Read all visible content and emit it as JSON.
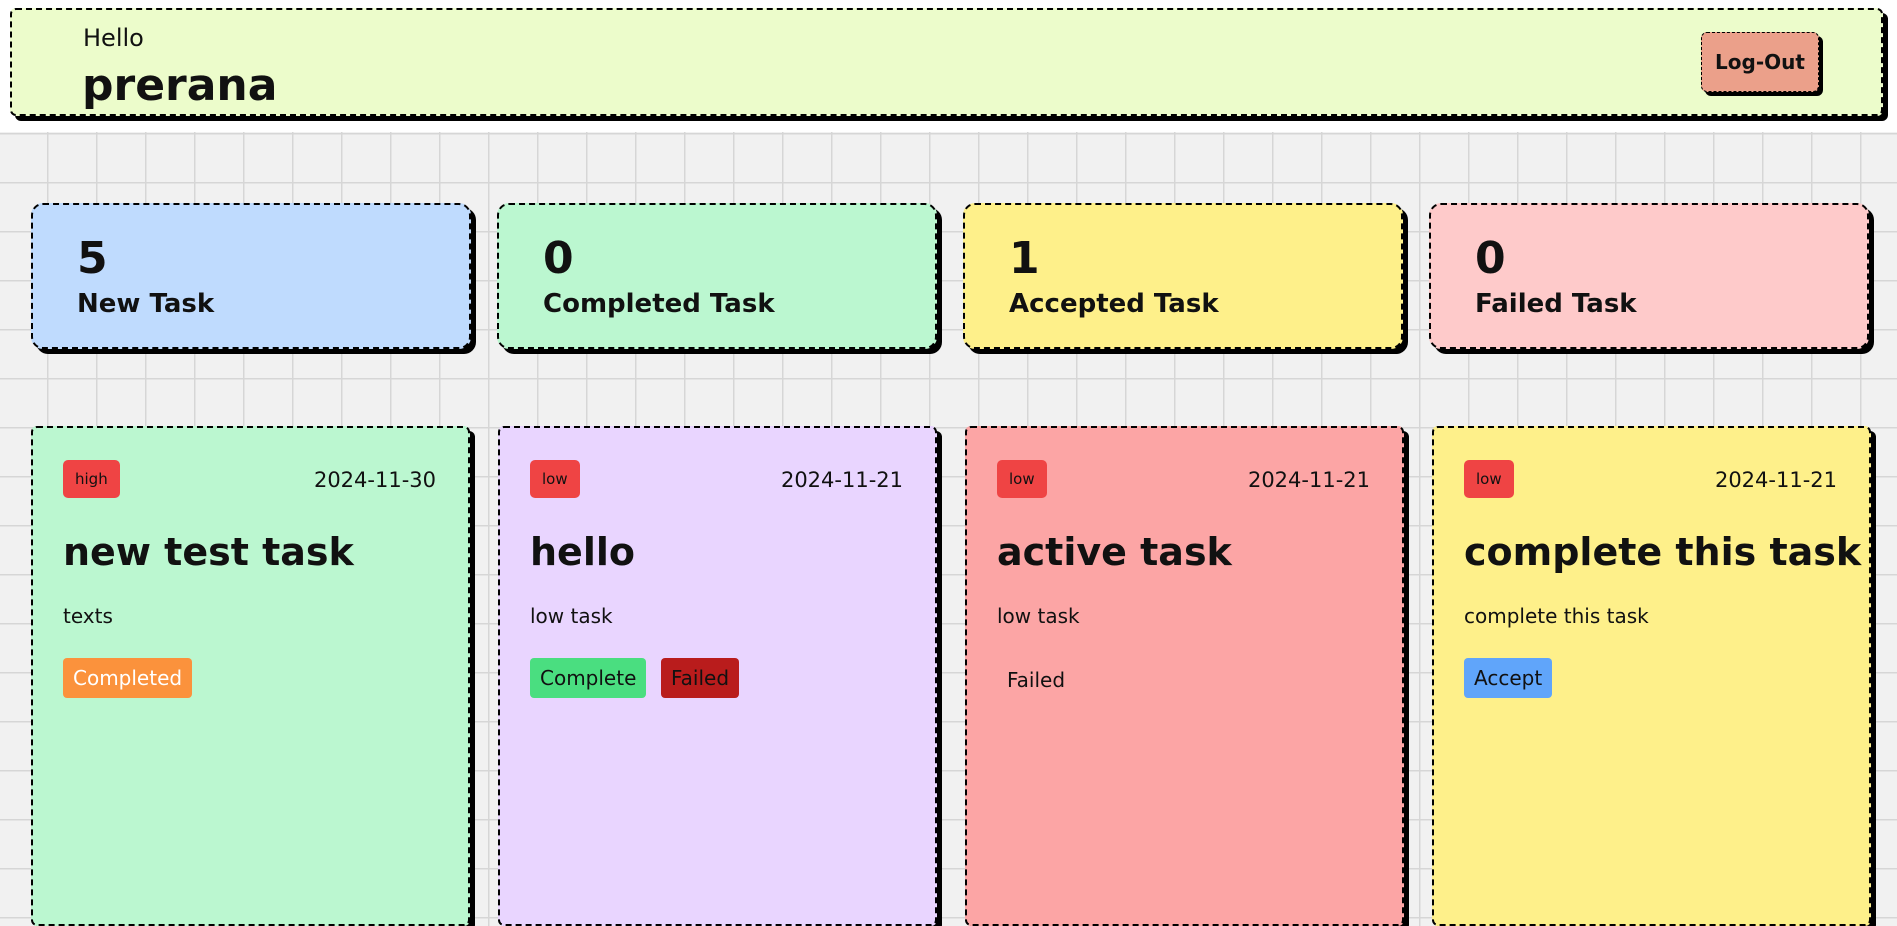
{
  "header": {
    "greeting": "Hello",
    "username": "prerana",
    "logout_label": "Log-Out",
    "background": "#ecfccb"
  },
  "stats": [
    {
      "count": "5",
      "label": "New Task",
      "color": "#bfdbfe"
    },
    {
      "count": "0",
      "label": "Completed Task",
      "color": "#bbf7d0"
    },
    {
      "count": "1",
      "label": "Accepted Task",
      "color": "#fef08a"
    },
    {
      "count": "0",
      "label": "Failed Task",
      "color": "#fecaca"
    }
  ],
  "tasks": [
    {
      "priority": "high",
      "date": "2024-11-30",
      "title": "new test task",
      "description": "texts",
      "status_button": "Completed",
      "color": "#bbf7d0"
    },
    {
      "priority": "low",
      "date": "2024-11-21",
      "title": "hello",
      "description": "low task",
      "complete_button": "Complete",
      "failed_button": "Failed",
      "color": "#e9d5ff"
    },
    {
      "priority": "low",
      "date": "2024-11-21",
      "title": "active task",
      "description": "low task",
      "status_text": "Failed",
      "color": "#fca5a5"
    },
    {
      "priority": "low",
      "date": "2024-11-21",
      "title": "complete this task",
      "description": "complete this task",
      "accept_button": "Accept",
      "color": "#fef08a"
    }
  ],
  "colors": {
    "priority_badge": "#ef4444",
    "completed_button": "#fb923c",
    "complete_button": "#4ade80",
    "failed_button": "#b91c1c",
    "accept_button": "#60a5fa",
    "logout_button": "#eba08a"
  }
}
